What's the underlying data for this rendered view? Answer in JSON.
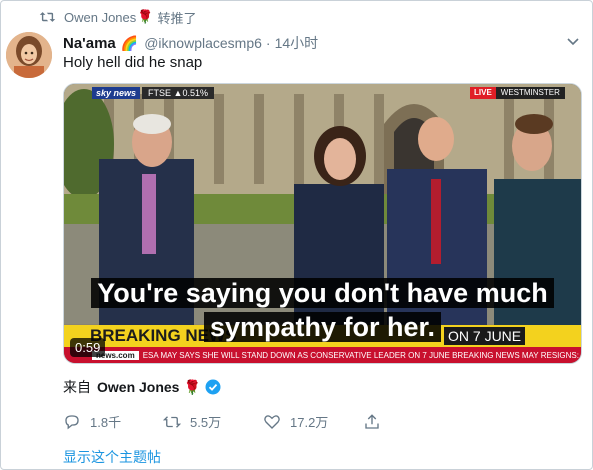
{
  "retweet": {
    "retweeter": "Owen Jones",
    "rose": "🌹",
    "action": "转推了"
  },
  "author": {
    "name": "Na'ama",
    "emoji": "🌈",
    "handle": "@iknowplacesmp6",
    "separator": "·",
    "time": "14小时"
  },
  "tweet": {
    "text": "Holy hell did he snap"
  },
  "video": {
    "channel_logo": "sky news",
    "ticker_index": "FTSE ▲0.51%",
    "live_label": "LIVE",
    "location": "WESTMINSTER",
    "subtitle_line1": "You're saying you don't have much",
    "subtitle_line2": "sympathy for her.",
    "breaking_label": "BREAKING NEWS",
    "headline_tail": "ON 7 JUNE",
    "site": "news.com",
    "ticker_text": "ESA MAY SAYS SHE WILL STAND DOWN AS CONSERVATIVE LEADER ON 7 JUNE  BREAKING NEWS  MAY RESIGNS: PR",
    "duration": "0:59"
  },
  "source": {
    "label": "来自",
    "name": "Owen Jones",
    "rose": "🌹"
  },
  "actions": {
    "replies": "1.8千",
    "retweets": "5.5万",
    "likes": "17.2万"
  },
  "thread_link": "显示这个主题帖",
  "colors": {
    "accent": "#1b95e0",
    "muted": "#657786",
    "rose": "#c8102e",
    "breaking_yellow": "#f3d21e"
  }
}
